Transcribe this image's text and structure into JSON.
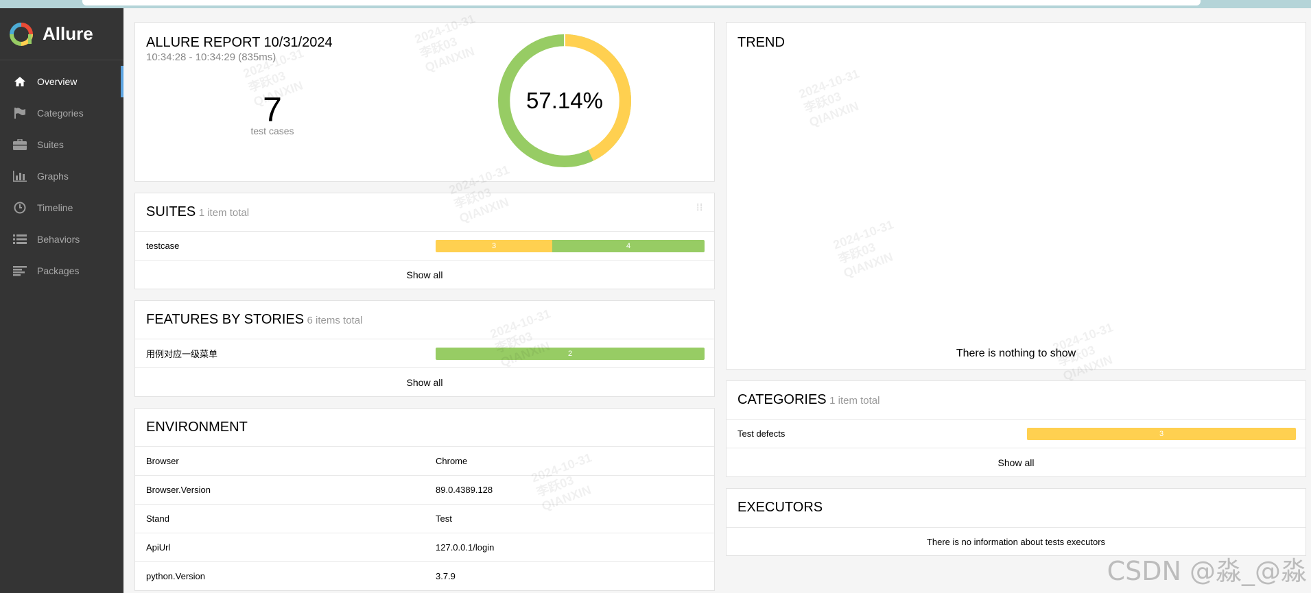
{
  "app": {
    "name": "Allure"
  },
  "nav": [
    {
      "label": "Overview",
      "icon": "home-icon",
      "active": true
    },
    {
      "label": "Categories",
      "icon": "flag-icon",
      "active": false
    },
    {
      "label": "Suites",
      "icon": "briefcase-icon",
      "active": false
    },
    {
      "label": "Graphs",
      "icon": "bar-chart-icon",
      "active": false
    },
    {
      "label": "Timeline",
      "icon": "clock-icon",
      "active": false
    },
    {
      "label": "Behaviors",
      "icon": "list-icon",
      "active": false
    },
    {
      "label": "Packages",
      "icon": "align-left-icon",
      "active": false
    }
  ],
  "summary": {
    "title": "ALLURE REPORT 10/31/2024",
    "time": "10:34:28 - 10:34:29 (835ms)",
    "count": "7",
    "count_label": "test cases",
    "percent": "57.14%",
    "donut": {
      "passed": 4,
      "broken": 3
    }
  },
  "suites": {
    "title": "SUITES",
    "total": "1 item total",
    "items": [
      {
        "name": "testcase",
        "broken": 3,
        "passed": 4
      }
    ],
    "show_all": "Show all"
  },
  "features": {
    "title": "FEATURES BY STORIES",
    "total": "6 items total",
    "items": [
      {
        "name": "用例对应一级菜单",
        "passed": 2
      }
    ],
    "show_all": "Show all"
  },
  "environment": {
    "title": "ENVIRONMENT",
    "rows": [
      {
        "key": "Browser",
        "value": "Chrome"
      },
      {
        "key": "Browser.Version",
        "value": "89.0.4389.128"
      },
      {
        "key": "Stand",
        "value": "Test"
      },
      {
        "key": "ApiUrl",
        "value": "127.0.0.1/login"
      },
      {
        "key": "python.Version",
        "value": "3.7.9"
      }
    ]
  },
  "trend": {
    "title": "TREND",
    "empty": "There is nothing to show"
  },
  "categories": {
    "title": "CATEGORIES",
    "total": "1 item total",
    "items": [
      {
        "name": "Test defects",
        "broken": 3
      }
    ],
    "show_all": "Show all"
  },
  "executors": {
    "title": "EXECUTORS",
    "empty": "There is no information about tests executors"
  },
  "watermark": {
    "date": "2024-10-31",
    "user": "李跃03",
    "company": "QIANXIN"
  },
  "csdn": "CSDN @淼_@淼",
  "colors": {
    "passed": "#97cc64",
    "broken": "#ffd050",
    "sidebar": "#343434",
    "active_accent": "#5ba3e0"
  }
}
